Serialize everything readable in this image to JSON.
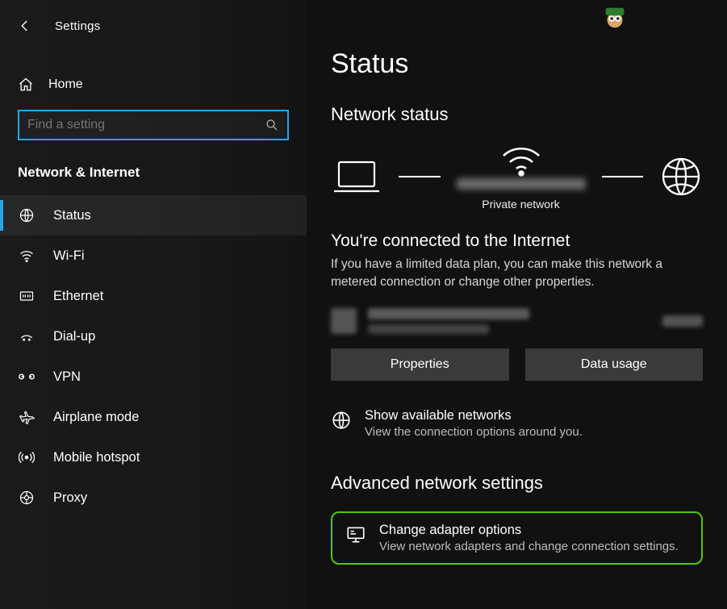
{
  "header": {
    "title": "Settings"
  },
  "home": {
    "label": "Home"
  },
  "search": {
    "placeholder": "Find a setting"
  },
  "section": {
    "title": "Network & Internet"
  },
  "nav": {
    "items": [
      {
        "icon": "globe-icon",
        "label": "Status",
        "active": true
      },
      {
        "icon": "wifi-icon",
        "label": "Wi-Fi"
      },
      {
        "icon": "ethernet-icon",
        "label": "Ethernet"
      },
      {
        "icon": "dialup-icon",
        "label": "Dial-up"
      },
      {
        "icon": "vpn-icon",
        "label": "VPN"
      },
      {
        "icon": "airplane-icon",
        "label": "Airplane mode"
      },
      {
        "icon": "hotspot-icon",
        "label": "Mobile hotspot"
      },
      {
        "icon": "proxy-icon",
        "label": "Proxy"
      }
    ]
  },
  "main": {
    "page_title": "Status",
    "network_status_heading": "Network status",
    "diagram_private": "Private network",
    "connected_heading": "You're connected to the Internet",
    "connected_body": "If you have a limited data plan, you can make this network a metered connection or change other properties.",
    "properties_btn": "Properties",
    "datausage_btn": "Data usage",
    "avail_title": "Show available networks",
    "avail_sub": "View the connection options around you.",
    "adv_heading": "Advanced network settings",
    "adapter_title": "Change adapter options",
    "adapter_sub": "View network adapters and change connection settings."
  }
}
